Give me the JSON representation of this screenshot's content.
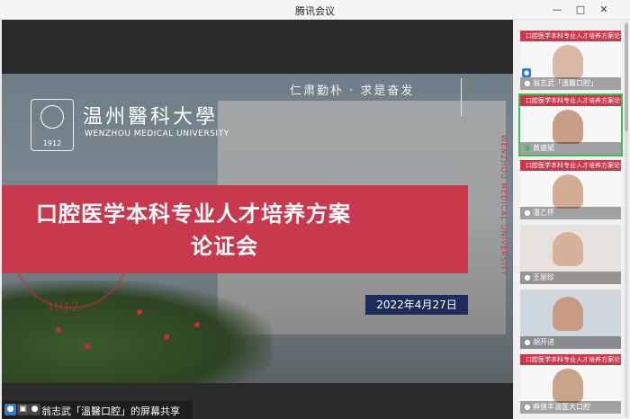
{
  "window": {
    "title": "腾讯会议",
    "minimize_icon": "minimize-icon",
    "maximize_icon": "maximize-icon",
    "close_icon": "close-icon"
  },
  "slide": {
    "motto": "仁肃勤朴 · 求是奋发",
    "university_cn": "温州醫科大學",
    "university_en": "WENZHOU MEDICAL UNIVERSITY",
    "seal_year": "1912",
    "vertical_text": "WENZHOU MEDICAL UNIVERSITY",
    "title_line1": "口腔医学本科专业人才培养方案",
    "title_line2": "论证会",
    "date": "2022年4月27日",
    "big_seal_year": "1912"
  },
  "share_bar": {
    "label": "翁志武「溫醫口腔」的屏幕共享"
  },
  "participants": [
    {
      "name": "翁志武「溫醫口腔」",
      "header": "口腔医学本科专业人才培养方案论证会",
      "active": false,
      "mic": "mic-icon",
      "face_color": "#d9b9a3"
    },
    {
      "name": "黄盛斌",
      "header": "口腔医学本科专业人才培养方案论证会",
      "active": true,
      "mic": "mic-icon",
      "face_color": "#c89e86"
    },
    {
      "name": "潘乙怀",
      "header": "口腔医学本科专业人才培养方案论证会",
      "active": false,
      "mic": "mic-icon",
      "face_color": "#d2ad93"
    },
    {
      "name": "王丽珍",
      "header": "",
      "active": false,
      "mic": "mic-icon",
      "face_color": "#d7b29a"
    },
    {
      "name": "胡开进",
      "header": "",
      "active": false,
      "mic": "mic-icon",
      "face_color": "#c79c83"
    },
    {
      "name": "麻健丰温医大口腔",
      "header": "口腔医学本科专业人才培养方案论证会",
      "active": false,
      "mic": "mic-icon",
      "face_color": "#c9a489"
    }
  ]
}
